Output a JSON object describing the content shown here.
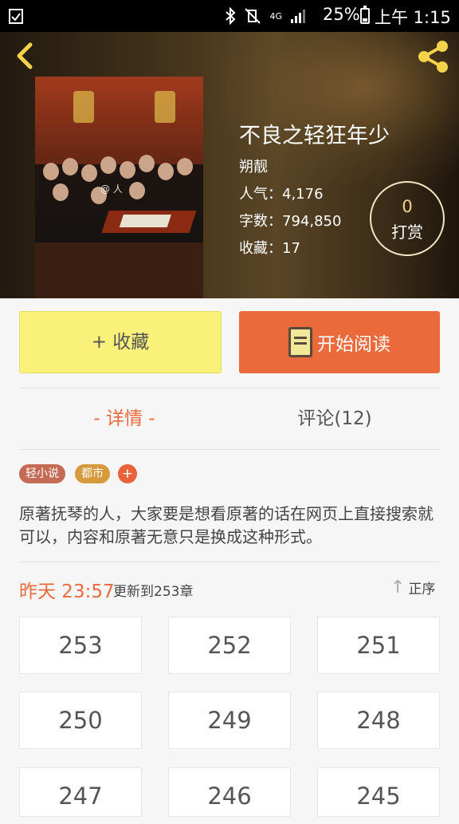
{
  "status_bar": {
    "signal_text": "4G",
    "battery": "25%",
    "time": "上午 1:15"
  },
  "header": {
    "back_icon": "chevron-left-icon",
    "share_icon": "share-icon",
    "cover_watermark": "@ 人",
    "title": "不良之轻狂年少",
    "author": "朔靓",
    "popularity": "人气：4,176",
    "word_count": "字数：794,850",
    "favorites": "收藏：17",
    "tip": {
      "count": "0",
      "label": "打赏"
    }
  },
  "actions": {
    "favorite_label": "+ 收藏",
    "read_label": "开始阅读"
  },
  "tabs": {
    "details": "- 详情 -",
    "comments": "评论(12)"
  },
  "tags": [
    {
      "label": "轻小说",
      "color": "#c56b55"
    },
    {
      "label": "都市",
      "color": "#d59a3c"
    }
  ],
  "tag_add": "+",
  "description": "原著抚琴的人，大家要是想看原著的话在网页上直接搜索就可以，内容和原著无意只是换成这种形式。",
  "update": {
    "time": "昨天 23:57",
    "text": "更新到253章",
    "sort_label": "正序",
    "sort_arrow": "↑"
  },
  "chapters": [
    "253",
    "252",
    "251",
    "250",
    "249",
    "248",
    "247",
    "246",
    "245"
  ],
  "colors": {
    "accent": "#ea6a3b",
    "favorite_bg": "#f9f17a",
    "page_bg": "#f6f6f6"
  }
}
